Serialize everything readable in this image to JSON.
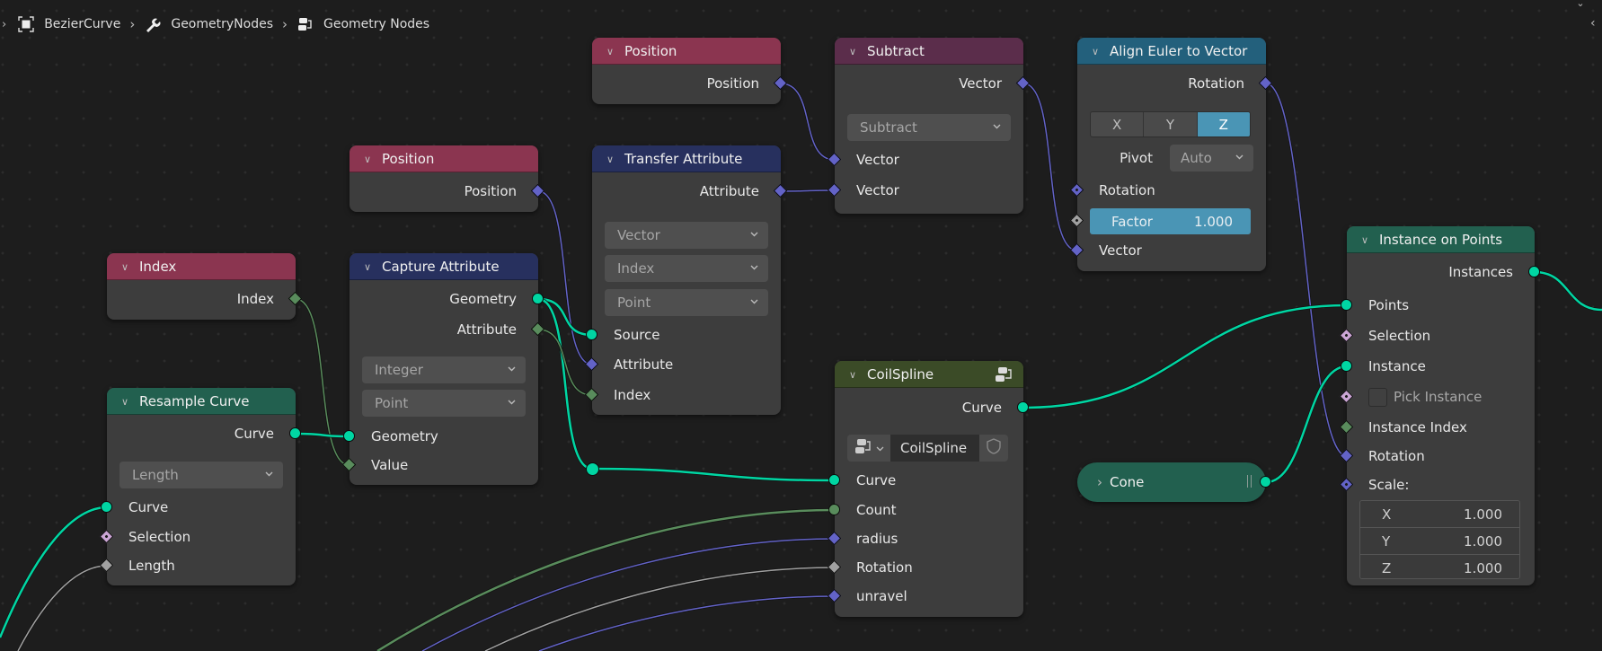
{
  "breadcrumb": {
    "items": [
      {
        "label": "BezierCurve",
        "icon": "object-icon"
      },
      {
        "label": "GeometryNodes",
        "icon": "wrench-icon"
      },
      {
        "label": "Geometry Nodes",
        "icon": "node-tree-icon"
      }
    ]
  },
  "colors": {
    "background": "#1d1d1d",
    "node_body": "#3d3d3d",
    "header_input": "#8b3550",
    "header_attribute": "#27305e",
    "header_geometry": "#22604f",
    "header_vector": "#5b2d4b",
    "header_converter": "#23607c",
    "header_group": "#3b4b27",
    "socket_geometry": "#00d6a3",
    "socket_vector": "#6363c7",
    "socket_integer": "#598c5c",
    "socket_float": "#a1a1a1",
    "socket_boolean": "#cca6d6",
    "accent_blue": "#4a95b5"
  },
  "nodes": {
    "position_a": {
      "title": "Position",
      "outputs": [
        "Position"
      ]
    },
    "position_b": {
      "title": "Position",
      "outputs": [
        "Position"
      ]
    },
    "index": {
      "title": "Index",
      "outputs": [
        "Index"
      ]
    },
    "subtract": {
      "title": "Subtract",
      "outputs": [
        "Vector"
      ],
      "operation": "Subtract",
      "inputs": [
        "Vector",
        "Vector"
      ]
    },
    "align_euler": {
      "title": "Align Euler to Vector",
      "outputs": [
        "Rotation"
      ],
      "axis_options": [
        "X",
        "Y",
        "Z"
      ],
      "axis_selected": "Z",
      "pivot_label": "Pivot",
      "pivot_value": "Auto",
      "inputs": [
        "Rotation",
        "Vector"
      ],
      "factor_label": "Factor",
      "factor_value": "1.000"
    },
    "transfer_attribute": {
      "title": "Transfer Attribute",
      "outputs": [
        "Attribute"
      ],
      "data_type": "Vector",
      "mapping": "Index",
      "domain": "Point",
      "inputs": [
        "Source",
        "Attribute",
        "Index"
      ]
    },
    "capture_attribute": {
      "title": "Capture Attribute",
      "outputs": [
        "Geometry",
        "Attribute"
      ],
      "data_type": "Integer",
      "domain": "Point",
      "inputs": [
        "Geometry",
        "Value"
      ]
    },
    "resample_curve": {
      "title": "Resample Curve",
      "outputs": [
        "Curve"
      ],
      "mode": "Length",
      "inputs": [
        "Curve",
        "Selection",
        "Length"
      ]
    },
    "coil_spline": {
      "title": "CoilSpline",
      "outputs": [
        "Curve"
      ],
      "group_name": "CoilSpline",
      "inputs": [
        "Curve",
        "Count",
        "radius",
        "Rotation",
        "unravel"
      ]
    },
    "cone": {
      "title": "Cone"
    },
    "instance_on_points": {
      "title": "Instance on Points",
      "outputs": [
        "Instances"
      ],
      "inputs": [
        "Points",
        "Selection",
        "Instance",
        "Pick Instance",
        "Instance Index",
        "Rotation",
        "Scale:"
      ],
      "pick_instance_checked": false,
      "scale": [
        {
          "axis": "X",
          "value": "1.000"
        },
        {
          "axis": "Y",
          "value": "1.000"
        },
        {
          "axis": "Z",
          "value": "1.000"
        }
      ]
    }
  }
}
